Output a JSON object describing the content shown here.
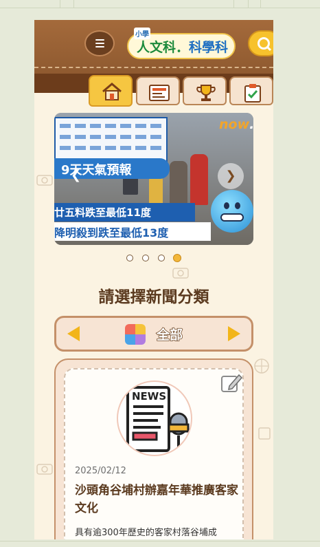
{
  "header": {
    "logo_small": "小學",
    "logo_main_left": "人文科",
    "logo_main_right": "科學科"
  },
  "tabs": [
    {
      "name": "home",
      "icon": "house-icon",
      "active": true
    },
    {
      "name": "news",
      "icon": "newspaper-icon",
      "active": false
    },
    {
      "name": "trophy",
      "icon": "trophy-icon",
      "active": false
    },
    {
      "name": "quiz",
      "icon": "clipboard-check-icon",
      "active": false
    }
  ],
  "carousel": {
    "brand": "now",
    "brand_suffix": "...",
    "headline_band": "9天天氣預報",
    "caption_line1": "廿五料跌至最低11度",
    "caption_line2": "降明殺到跌至最低13度",
    "slide_count": 4,
    "active_slide": 4
  },
  "section": {
    "title": "請選擇新聞分類"
  },
  "category": {
    "label": "全部"
  },
  "news": [
    {
      "image_label": "NEWS",
      "date": "2025/02/12",
      "title": "沙頭角谷埔村辦嘉年華推廣客家文化",
      "excerpt": "具有逾300年歷史的客家村落谷埔成"
    }
  ],
  "colors": {
    "header_brown": "#a46a3b",
    "accent_yellow": "#f6c641",
    "page_cream": "#fbf3e2",
    "title_brown": "#5b3a1f"
  }
}
